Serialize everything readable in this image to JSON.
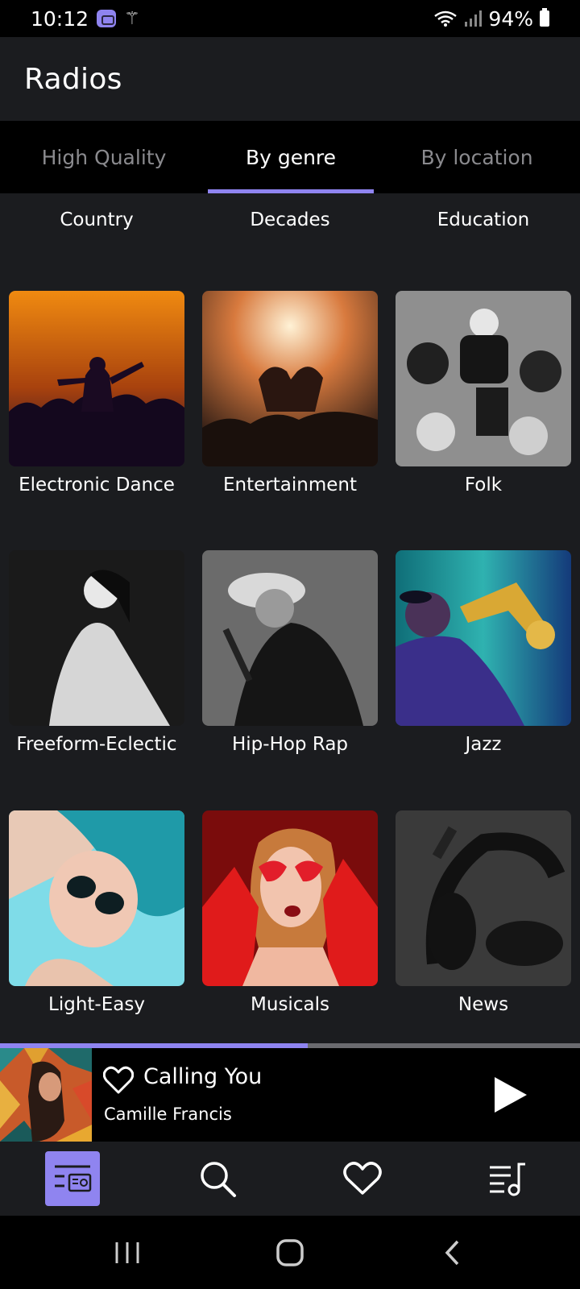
{
  "status_bar": {
    "time": "10:12",
    "battery": "94%"
  },
  "app_bar": {
    "title": "Radios"
  },
  "tabs": [
    {
      "label": "High Quality",
      "active": false
    },
    {
      "label": "By genre",
      "active": true
    },
    {
      "label": "By location",
      "active": false
    }
  ],
  "genres_partial": [
    {
      "label": "Country"
    },
    {
      "label": "Decades"
    },
    {
      "label": "Education"
    }
  ],
  "genres": [
    {
      "label": "Electronic Dance"
    },
    {
      "label": "Entertainment"
    },
    {
      "label": "Folk"
    },
    {
      "label": "Freeform-Eclectic"
    },
    {
      "label": "Hip-Hop Rap"
    },
    {
      "label": "Jazz"
    },
    {
      "label": "Light-Easy"
    },
    {
      "label": "Musicals"
    },
    {
      "label": "News"
    }
  ],
  "player": {
    "title": "Calling You",
    "artist": "Camille Francis",
    "progress": 0.53
  },
  "bottom_nav": [
    {
      "icon": "radio-list-icon",
      "active": true
    },
    {
      "icon": "search-icon",
      "active": false
    },
    {
      "icon": "heart-icon",
      "active": false
    },
    {
      "icon": "playlist-icon",
      "active": false
    }
  ],
  "colors": {
    "accent": "#8f84f0",
    "background": "#1b1c1f"
  }
}
